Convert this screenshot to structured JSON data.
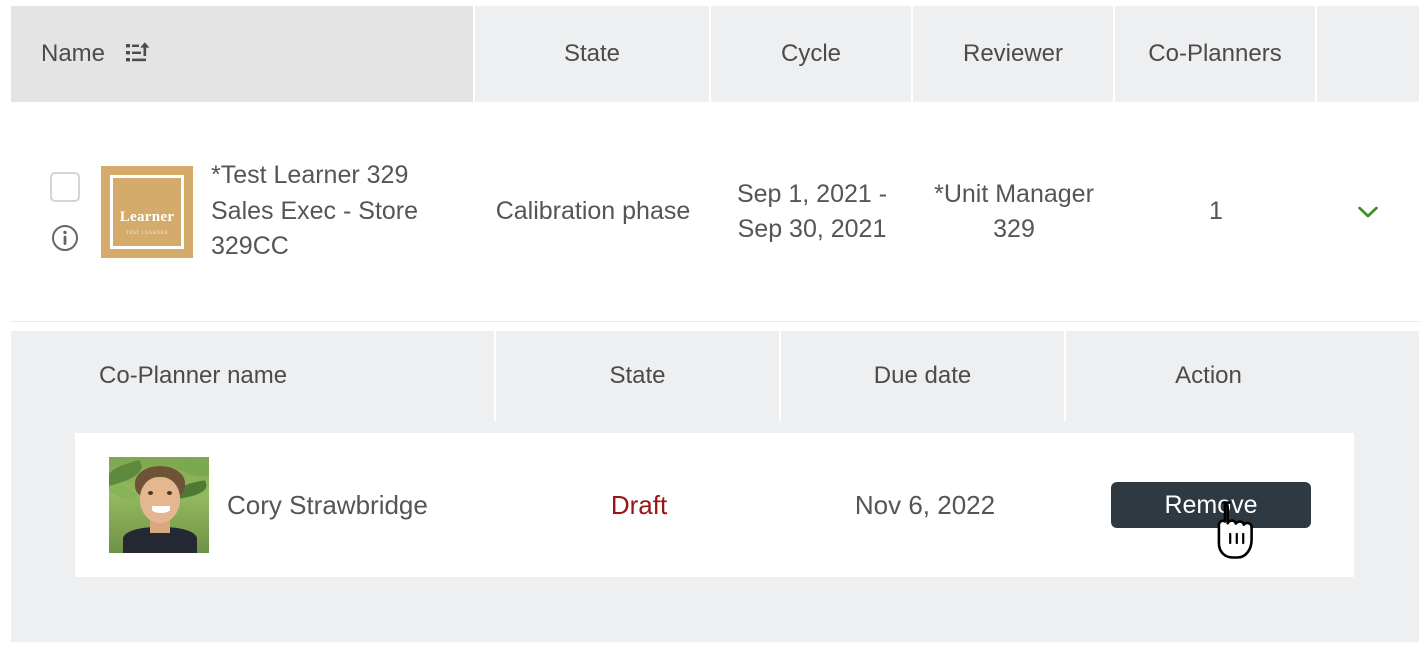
{
  "main_table": {
    "columns": [
      {
        "key": "name",
        "label": "Name",
        "sort_icon": "sort-ascending-icon"
      },
      {
        "key": "state",
        "label": "State"
      },
      {
        "key": "cycle",
        "label": "Cycle"
      },
      {
        "key": "reviewer",
        "label": "Reviewer"
      },
      {
        "key": "coplanners",
        "label": "Co-Planners"
      },
      {
        "key": "expand",
        "label": ""
      }
    ],
    "rows": [
      {
        "checkbox_checked": false,
        "info_icon": "info-circle-icon",
        "thumbnail": {
          "title": "Learner",
          "subtitle": "TEST LEARNER",
          "background_color": "#d4ab6a"
        },
        "name": "*Test Learner 329 Sales Exec - Store 329CC",
        "state": "Calibration phase",
        "cycle": "Sep 1, 2021 - Sep 30, 2021",
        "reviewer": "*Unit Manager 329",
        "coplanners": "1",
        "expand_icon": "chevron-down-icon",
        "expand_icon_color": "#3e8c20"
      }
    ]
  },
  "sub_table": {
    "columns": [
      {
        "key": "coplanner_name",
        "label": "Co-Planner name"
      },
      {
        "key": "state",
        "label": "State"
      },
      {
        "key": "due_date",
        "label": "Due date"
      },
      {
        "key": "action",
        "label": "Action"
      }
    ],
    "rows": [
      {
        "avatar": "user-photo-avatar",
        "name": "Cory Strawbridge",
        "state": "Draft",
        "state_color": "#9b1313",
        "due_date": "Nov 6, 2022",
        "action_label": "Remove",
        "action_color": "#2e3942"
      }
    ]
  },
  "cursor": {
    "icon": "pointing-hand-cursor"
  },
  "colors": {
    "header_bg": "#eeeff0",
    "name_header_bg": "#e4e4e5",
    "panel_bg": "#eeeff0",
    "row_bg": "#ffffff",
    "text": "#555555",
    "accent_green": "#3e8c20",
    "danger_red": "#9b1313",
    "button_dark": "#2e3942"
  }
}
